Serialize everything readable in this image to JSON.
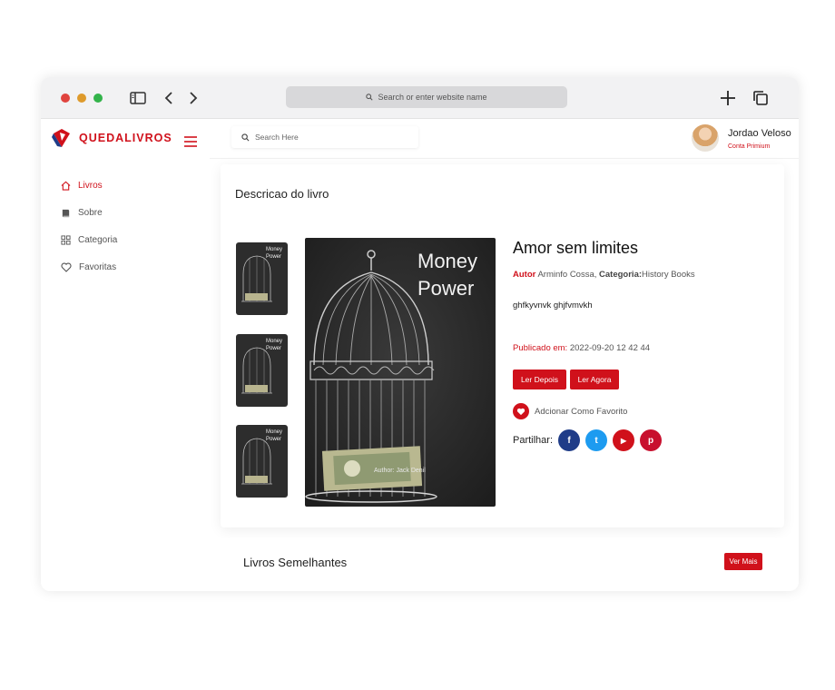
{
  "browser": {
    "address_placeholder": "Search or enter website name"
  },
  "brand": {
    "name": "QUEDALIVROS"
  },
  "sidebar": {
    "items": [
      {
        "label": "Livros",
        "icon": "home-icon",
        "active": true
      },
      {
        "label": "Sobre",
        "icon": "book-icon",
        "active": false
      },
      {
        "label": "Categoria",
        "icon": "grid-icon",
        "active": false
      },
      {
        "label": "Favoritas",
        "icon": "heart-icon",
        "active": false
      }
    ]
  },
  "topbar": {
    "search_placeholder": "Search Here",
    "user_name": "Jordao Veloso",
    "user_plan": "Conta Primium"
  },
  "book": {
    "section_title": "Descricao do livro",
    "title": "Amor sem limites",
    "author_label": "Autor",
    "author": "Arminfo Cossa,",
    "category_label": "Categoria:",
    "category": "History Books",
    "description": "ghfkyvnvk ghjfvmvkh",
    "published_label": "Publicado em:",
    "published_value": "2022-09-20 12 42 44",
    "read_later": "Ler Depois",
    "read_now": "Ler Agora",
    "add_favorite": "Adcionar Como Favorito",
    "share_label": "Partilhar:",
    "cover_title_line1": "Money",
    "cover_title_line2": "Power",
    "cover_author": "Author: Jack Denil"
  },
  "social": [
    {
      "name": "facebook",
      "glyph": "f",
      "color": "#1f3c88"
    },
    {
      "name": "twitter",
      "glyph": "t",
      "color": "#1d9bf0"
    },
    {
      "name": "youtube",
      "glyph": "▶",
      "color": "#d0111b"
    },
    {
      "name": "pinterest",
      "glyph": "p",
      "color": "#c8102e"
    }
  ],
  "similar": {
    "title": "Livros Semelhantes",
    "see_more": "Ver Mais"
  },
  "colors": {
    "accent": "#d0111b"
  }
}
